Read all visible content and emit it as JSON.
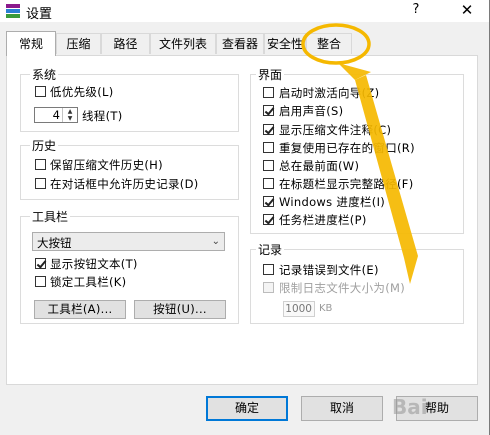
{
  "window": {
    "title": "设置",
    "help_glyph": "?",
    "close_glyph": "✕"
  },
  "tabs": [
    {
      "label": "常规"
    },
    {
      "label": "压缩"
    },
    {
      "label": "路径"
    },
    {
      "label": "文件列表"
    },
    {
      "label": "查看器"
    },
    {
      "label": "安全性"
    },
    {
      "label": "整合"
    }
  ],
  "system": {
    "title": "系统",
    "low_priority": "低优先级(L)",
    "threads_value": "4",
    "threads_label": "线程(T)"
  },
  "history": {
    "title": "历史",
    "keep": "保留压缩文件历史(H)",
    "allow": "在对话框中允许历史记录(D)"
  },
  "toolbar": {
    "title": "工具栏",
    "style_value": "大按钮",
    "show_text": "显示按钮文本(T)",
    "lock": "锁定工具栏(K)",
    "toolbar_btn": "工具栏(A)...",
    "buttons_btn": "按钮(U)..."
  },
  "interface": {
    "title": "界面",
    "items": [
      {
        "label": "启动时激活向导(Z)",
        "checked": false
      },
      {
        "label": "启用声音(S)",
        "checked": true
      },
      {
        "label": "显示压缩文件注释(C)",
        "checked": true
      },
      {
        "label": "重复使用已存在的窗口(R)",
        "checked": false
      },
      {
        "label": "总在最前面(W)",
        "checked": false
      },
      {
        "label": "在标题栏显示完整路径(F)",
        "checked": false
      },
      {
        "label": "Windows 进度栏(I)",
        "checked": true
      },
      {
        "label": "任务栏进度栏(P)",
        "checked": true
      }
    ]
  },
  "log": {
    "title": "记录",
    "log_errors": "记录错误到文件(E)",
    "limit": "限制日志文件大小为(M)",
    "size_value": "1000",
    "size_unit": "KB"
  },
  "dialog_buttons": {
    "ok": "确定",
    "cancel": "取消",
    "help": "帮助"
  },
  "spinner_glyphs": {
    "up": "▲",
    "down": "▼"
  },
  "select_arrow": "⌄",
  "annotation_color": "#f5b800",
  "watermark": "Bai"
}
